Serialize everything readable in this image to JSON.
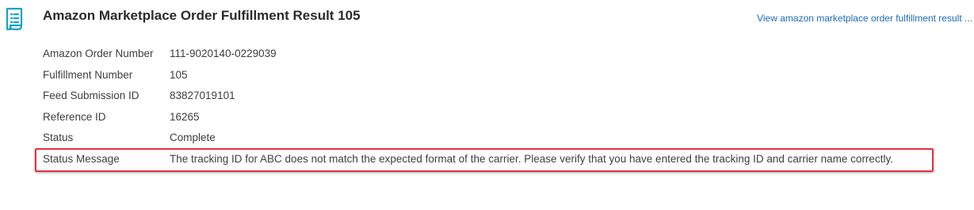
{
  "header": {
    "title": "Amazon Marketplace Order Fulfillment Result 105",
    "icon": "record-list-icon",
    "view_link": "View amazon marketplace order fulfillment result ..."
  },
  "fields": [
    {
      "label": "Amazon Order Number",
      "value": "111-9020140-0229039"
    },
    {
      "label": "Fulfillment Number",
      "value": "105"
    },
    {
      "label": "Feed Submission ID",
      "value": "83827019101"
    },
    {
      "label": "Reference ID",
      "value": "16265"
    },
    {
      "label": "Status",
      "value": "Complete"
    },
    {
      "label": "Status Message",
      "value": "The tracking ID for ABC does not match the expected format of the carrier. Please verify that you have entered the tracking ID and carrier name correctly."
    }
  ],
  "colors": {
    "icon": "#1aa3c5",
    "link": "#1a6bb8",
    "highlight": "#e0343d"
  }
}
